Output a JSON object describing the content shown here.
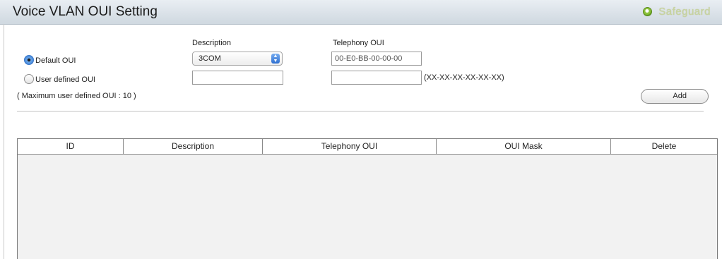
{
  "header": {
    "title": "Voice VLAN OUI Setting",
    "safeguard_label": "Safeguard"
  },
  "form": {
    "description_header": "Description",
    "telephony_oui_header": "Telephony OUI",
    "default_oui": {
      "label": "Default OUI",
      "checked": true,
      "description_value": "3COM",
      "telephony_oui_value": "00-E0-BB-00-00-00"
    },
    "user_defined_oui": {
      "label": "User defined OUI",
      "checked": false,
      "description_value": "",
      "telephony_oui_value": "",
      "format_hint": "(XX-XX-XX-XX-XX-XX)"
    },
    "max_note": "( Maximum user defined OUI : 10 )",
    "add_button": "Add"
  },
  "table": {
    "columns": [
      "ID",
      "Description",
      "Telephony OUI",
      "OUI Mask",
      "Delete"
    ],
    "rows": []
  },
  "colors": {
    "header_bg": "#dfe6ec",
    "safeguard_icon": "#6aa52a",
    "radio_selected": "#2f74d0"
  },
  "icons": {
    "safeguard": "safeguard-status-icon",
    "select_arrow": "select-stepper-arrows-icon"
  }
}
